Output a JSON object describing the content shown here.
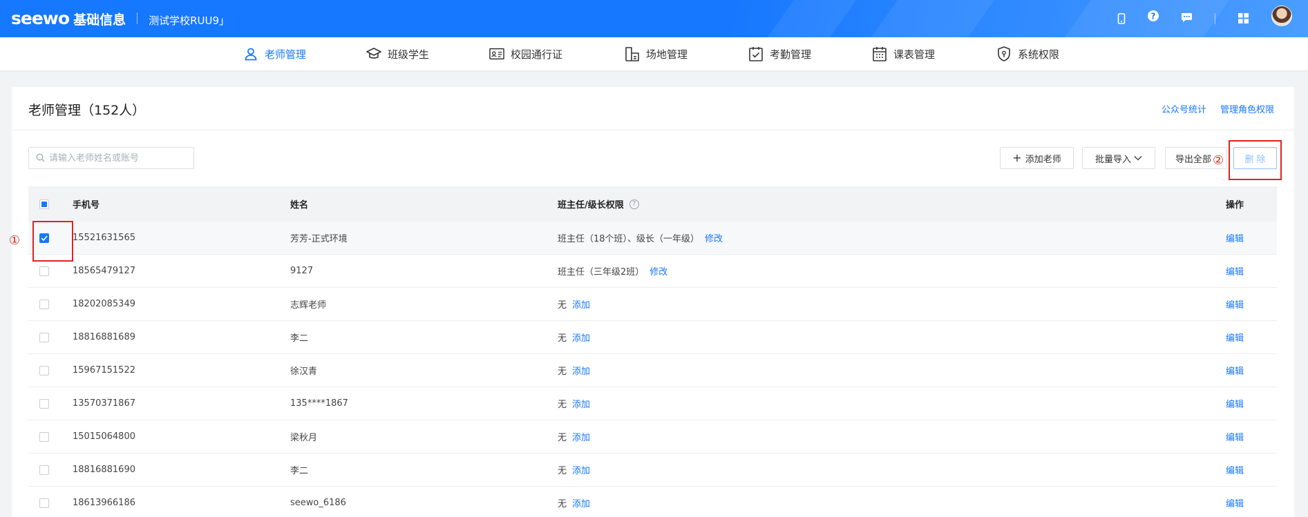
{
  "header": {
    "logo": "seewo",
    "system_name": "基础信息",
    "school": "测试学校RUU9」",
    "icons": [
      "phone-icon",
      "help-circle-icon",
      "message-icon",
      "apps-grid-icon",
      "avatar"
    ]
  },
  "nav": {
    "items": [
      {
        "label": "老师管理",
        "icon": "user-icon",
        "active": true
      },
      {
        "label": "班级学生",
        "icon": "graduation-cap-icon",
        "active": false
      },
      {
        "label": "校园通行证",
        "icon": "id-card-icon",
        "active": false
      },
      {
        "label": "场地管理",
        "icon": "building-icon",
        "active": false
      },
      {
        "label": "考勤管理",
        "icon": "attendance-icon",
        "active": false
      },
      {
        "label": "课表管理",
        "icon": "calendar-icon",
        "active": false
      },
      {
        "label": "系统权限",
        "icon": "shield-icon",
        "active": false
      }
    ]
  },
  "page": {
    "title": "老师管理（152人）",
    "links": {
      "stats": "公众号统计",
      "roles": "管理角色权限"
    }
  },
  "toolbar": {
    "search_placeholder": "请输入老师姓名或账号",
    "add_teacher": "添加老师",
    "batch_import": "批量导入",
    "export_all": "导出全部",
    "delete": "删 除"
  },
  "table": {
    "headers": {
      "phone": "手机号",
      "name": "姓名",
      "permission": "班主任/级长权限",
      "action": "操作"
    },
    "rows": [
      {
        "phone": "15521631565",
        "name": "芳芳-正式环境",
        "permission": "班主任（18个班）、级长（一年级）",
        "perm_action": "修改",
        "action": "编辑",
        "checked": true
      },
      {
        "phone": "18565479127",
        "name": "9127",
        "permission": "班主任（三年级2班）",
        "perm_action": "修改",
        "action": "编辑",
        "checked": false
      },
      {
        "phone": "18202085349",
        "name": "志辉老师",
        "permission": "无",
        "perm_action": "添加",
        "action": "编辑",
        "checked": false
      },
      {
        "phone": "18816881689",
        "name": "李二",
        "permission": "无",
        "perm_action": "添加",
        "action": "编辑",
        "checked": false
      },
      {
        "phone": "15967151522",
        "name": "徐汉青",
        "permission": "无",
        "perm_action": "添加",
        "action": "编辑",
        "checked": false
      },
      {
        "phone": "13570371867",
        "name": "135****1867",
        "permission": "无",
        "perm_action": "添加",
        "action": "编辑",
        "checked": false
      },
      {
        "phone": "15015064800",
        "name": "梁秋月",
        "permission": "无",
        "perm_action": "添加",
        "action": "编辑",
        "checked": false
      },
      {
        "phone": "18816881690",
        "name": "李二",
        "permission": "无",
        "perm_action": "添加",
        "action": "编辑",
        "checked": false
      },
      {
        "phone": "18613966186",
        "name": "seewo_6186",
        "permission": "无",
        "perm_action": "添加",
        "action": "编辑",
        "checked": false
      }
    ]
  },
  "annotations": {
    "step1": "①",
    "step2": "②"
  },
  "colors": {
    "primary": "#1677ff",
    "annotation": "#e02020"
  }
}
